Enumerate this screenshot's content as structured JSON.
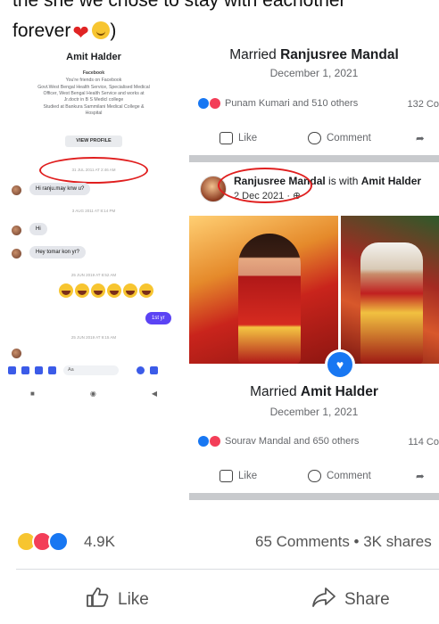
{
  "caption": {
    "line1": "the she we chose to stay with eachother",
    "line2": "forever",
    "line2_end": ")"
  },
  "messenger": {
    "profile_name": "Amit Halder",
    "network": "Facebook",
    "friends_line": "You're friends on Facebook",
    "work_line1": "Govt.West Bengal Health Service, Specialised Medical",
    "work_line2": "Officer, West Bengal Health Service and works at",
    "work_line3": "Jr.doctr in B S Medicl college",
    "study_line1": "Studied at Bankura Sammilani Medical College &",
    "study_line2": "Hospital",
    "view_profile": "VIEW PROFILE",
    "ts1": "31 JUL 2011 AT 2:46 AM",
    "msg1": "Hi ranju.may knw u?",
    "ts2": "3 AUG 2011 AT 8:14 PM",
    "msg2": "Hi",
    "msg3": "Hey tomar kon yr?",
    "ts3": "25 JUN 2019 AT 8:52 AM",
    "msg_out": "1st yr",
    "ts4": "25 JUN 2019 AT 9:15 AM",
    "composer_placeholder": "Aa"
  },
  "post_top": {
    "title_regular": "Married ",
    "title_bold": "Ranjusree Mandal",
    "date": "December 1, 2021",
    "reactions_text": "Punam Kumari and 510 others",
    "comments": "132 Co",
    "like": "Like",
    "comment": "Comment"
  },
  "post_main": {
    "poster_name": "Ranjusree Mandal",
    "with_text": "is with",
    "with_name": "Amit Halder",
    "date": "2 Dec 2021 · ",
    "title_regular": "Married ",
    "title_bold": "Amit Halder",
    "event_date": "December 1, 2021",
    "reactions_text": "Sourav Mandal and 650 others",
    "comments": "114 Co",
    "like": "Like",
    "comment": "Comment"
  },
  "bottom": {
    "reaction_count": "4.9K",
    "comments_shares": "65 Comments • 3K shares",
    "like": "Like",
    "share": "Share"
  },
  "colors": {
    "facebook_blue": "#1877f2",
    "love_red": "#f33e58",
    "annotation_red": "#e01f1f",
    "messenger_purple": "#5b43f4"
  }
}
